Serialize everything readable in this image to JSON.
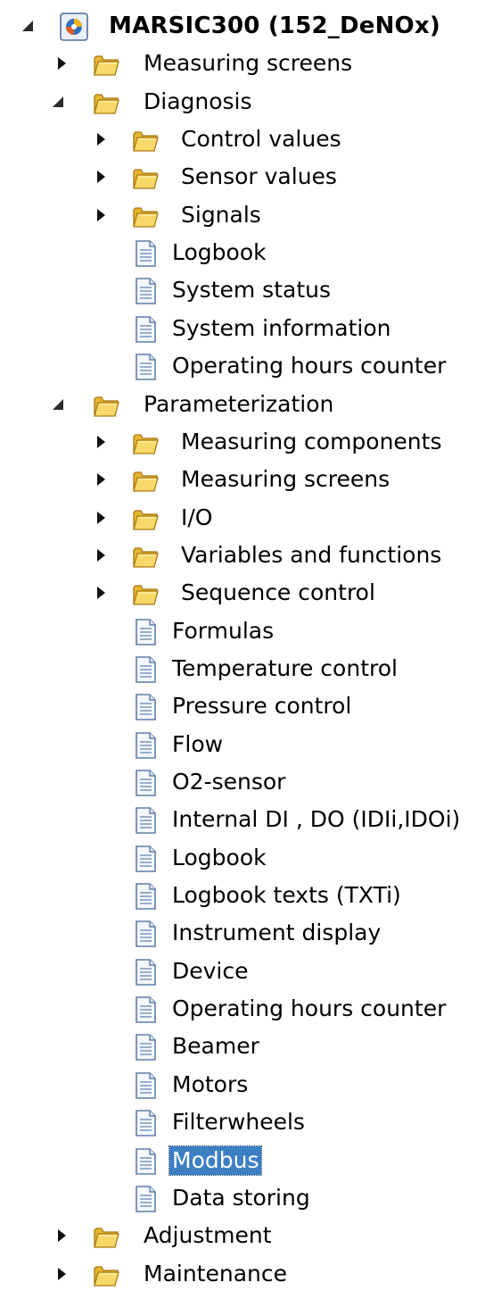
{
  "accent_colors": {
    "selection_background": "#3d7fc3",
    "selection_text": "#ffffff",
    "folder_yellow": "#f1c94c",
    "document_blue": "#9fb8d6"
  },
  "tree": {
    "nodes": [
      {
        "label": "MARSIC300 (152_DeNOx)",
        "level": 0,
        "icon": "device-icon",
        "state": "expanded",
        "root": true
      },
      {
        "label": "Measuring screens",
        "level": 1,
        "icon": "folder-icon",
        "state": "collapsed"
      },
      {
        "label": "Diagnosis",
        "level": 1,
        "icon": "folder-icon",
        "state": "expanded"
      },
      {
        "label": "Control values",
        "level": 2,
        "icon": "folder-icon",
        "state": "collapsed"
      },
      {
        "label": "Sensor values",
        "level": 2,
        "icon": "folder-icon",
        "state": "collapsed"
      },
      {
        "label": "Signals",
        "level": 2,
        "icon": "folder-icon",
        "state": "collapsed"
      },
      {
        "label": "Logbook",
        "level": 2,
        "icon": "document-icon",
        "state": "leaf"
      },
      {
        "label": "System status",
        "level": 2,
        "icon": "document-icon",
        "state": "leaf"
      },
      {
        "label": "System information",
        "level": 2,
        "icon": "document-icon",
        "state": "leaf"
      },
      {
        "label": "Operating hours counter",
        "level": 2,
        "icon": "document-icon",
        "state": "leaf"
      },
      {
        "label": "Parameterization",
        "level": 1,
        "icon": "folder-icon",
        "state": "expanded"
      },
      {
        "label": "Measuring components",
        "level": 2,
        "icon": "folder-icon",
        "state": "collapsed"
      },
      {
        "label": "Measuring screens",
        "level": 2,
        "icon": "folder-icon",
        "state": "collapsed"
      },
      {
        "label": "I/O",
        "level": 2,
        "icon": "folder-icon",
        "state": "collapsed"
      },
      {
        "label": "Variables and functions",
        "level": 2,
        "icon": "folder-icon",
        "state": "collapsed"
      },
      {
        "label": "Sequence control",
        "level": 2,
        "icon": "folder-icon",
        "state": "collapsed"
      },
      {
        "label": "Formulas",
        "level": 2,
        "icon": "document-icon",
        "state": "leaf"
      },
      {
        "label": "Temperature control",
        "level": 2,
        "icon": "document-icon",
        "state": "leaf"
      },
      {
        "label": "Pressure control",
        "level": 2,
        "icon": "document-icon",
        "state": "leaf"
      },
      {
        "label": "Flow",
        "level": 2,
        "icon": "document-icon",
        "state": "leaf"
      },
      {
        "label": "O2-sensor",
        "level": 2,
        "icon": "document-icon",
        "state": "leaf"
      },
      {
        "label": "Internal DI , DO (IDIi,IDOi)",
        "level": 2,
        "icon": "document-icon",
        "state": "leaf"
      },
      {
        "label": "Logbook",
        "level": 2,
        "icon": "document-icon",
        "state": "leaf"
      },
      {
        "label": "Logbook texts (TXTi)",
        "level": 2,
        "icon": "document-icon",
        "state": "leaf"
      },
      {
        "label": "Instrument display",
        "level": 2,
        "icon": "document-icon",
        "state": "leaf"
      },
      {
        "label": "Device",
        "level": 2,
        "icon": "document-icon",
        "state": "leaf"
      },
      {
        "label": "Operating hours counter",
        "level": 2,
        "icon": "document-icon",
        "state": "leaf"
      },
      {
        "label": "Beamer",
        "level": 2,
        "icon": "document-icon",
        "state": "leaf"
      },
      {
        "label": "Motors",
        "level": 2,
        "icon": "document-icon",
        "state": "leaf"
      },
      {
        "label": "Filterwheels",
        "level": 2,
        "icon": "document-icon",
        "state": "leaf"
      },
      {
        "label": "Modbus",
        "level": 2,
        "icon": "document-icon",
        "state": "leaf",
        "selected": true
      },
      {
        "label": "Data storing",
        "level": 2,
        "icon": "document-icon",
        "state": "leaf"
      },
      {
        "label": "Adjustment",
        "level": 1,
        "icon": "folder-icon",
        "state": "collapsed"
      },
      {
        "label": "Maintenance",
        "level": 1,
        "icon": "folder-icon",
        "state": "collapsed"
      }
    ]
  }
}
